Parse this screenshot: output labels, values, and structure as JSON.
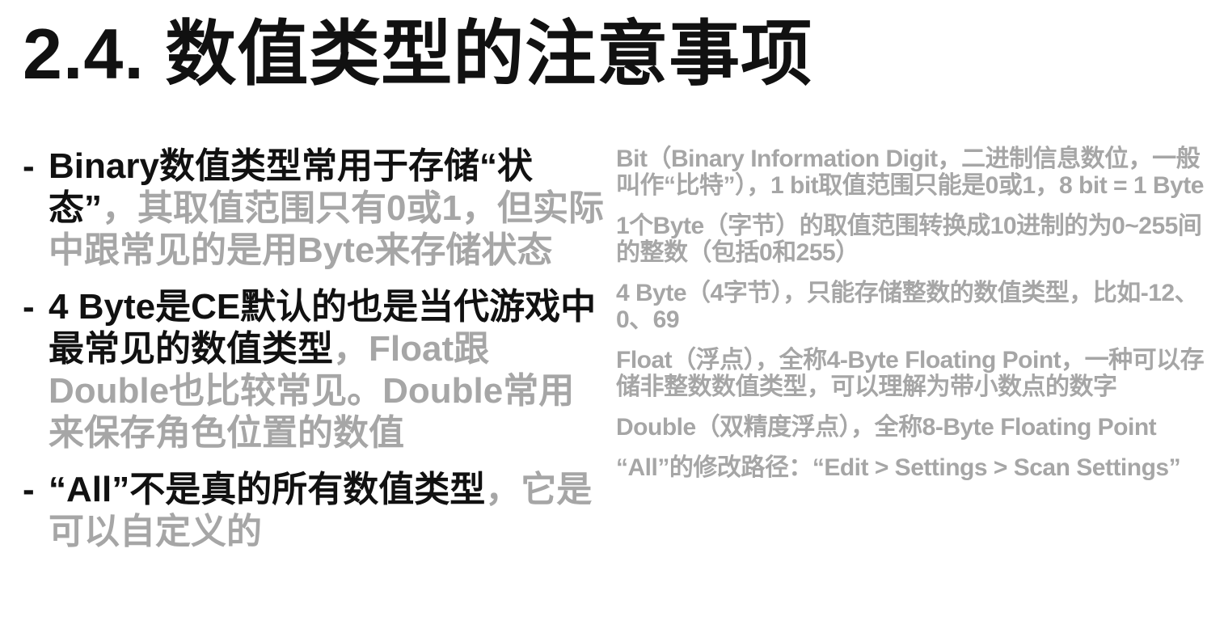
{
  "slide": {
    "title": "2.4. 数值类型的注意事项",
    "bullets": [
      {
        "dash": "-",
        "emphasis": "Binary数值类型常用于存储“状态”",
        "rest": "，其取值范围只有0或1，但实际中跟常见的是用Byte来存储状态"
      },
      {
        "dash": "-",
        "emphasis": "4 Byte是CE默认的也是当代游戏中最常见的数值类型",
        "rest": "，Float跟Double也比较常见。Double常用来保存角色位置的数值"
      },
      {
        "dash": "-",
        "emphasis": "“All”不是真的所有数值类型",
        "rest": "，它是可以自定义的"
      }
    ],
    "notes": [
      "Bit（Binary Information Digit，二进制信息数位，一般叫作“比特”），1 bit取值范围只能是0或1，8 bit = 1 Byte",
      "1个Byte（字节）的取值范围转换成10进制的为0~255间的整数（包括0和255）",
      "4 Byte（4字节），只能存储整数的数值类型，比如-12、0、69",
      "Float（浮点），全称4-Byte Floating Point，一种可以存储非整数数值类型，可以理解为带小数点的数字",
      "Double（双精度浮点），全称8-Byte Floating Point",
      "“All”的修改路径：“Edit > Settings > Scan Settings”"
    ]
  }
}
